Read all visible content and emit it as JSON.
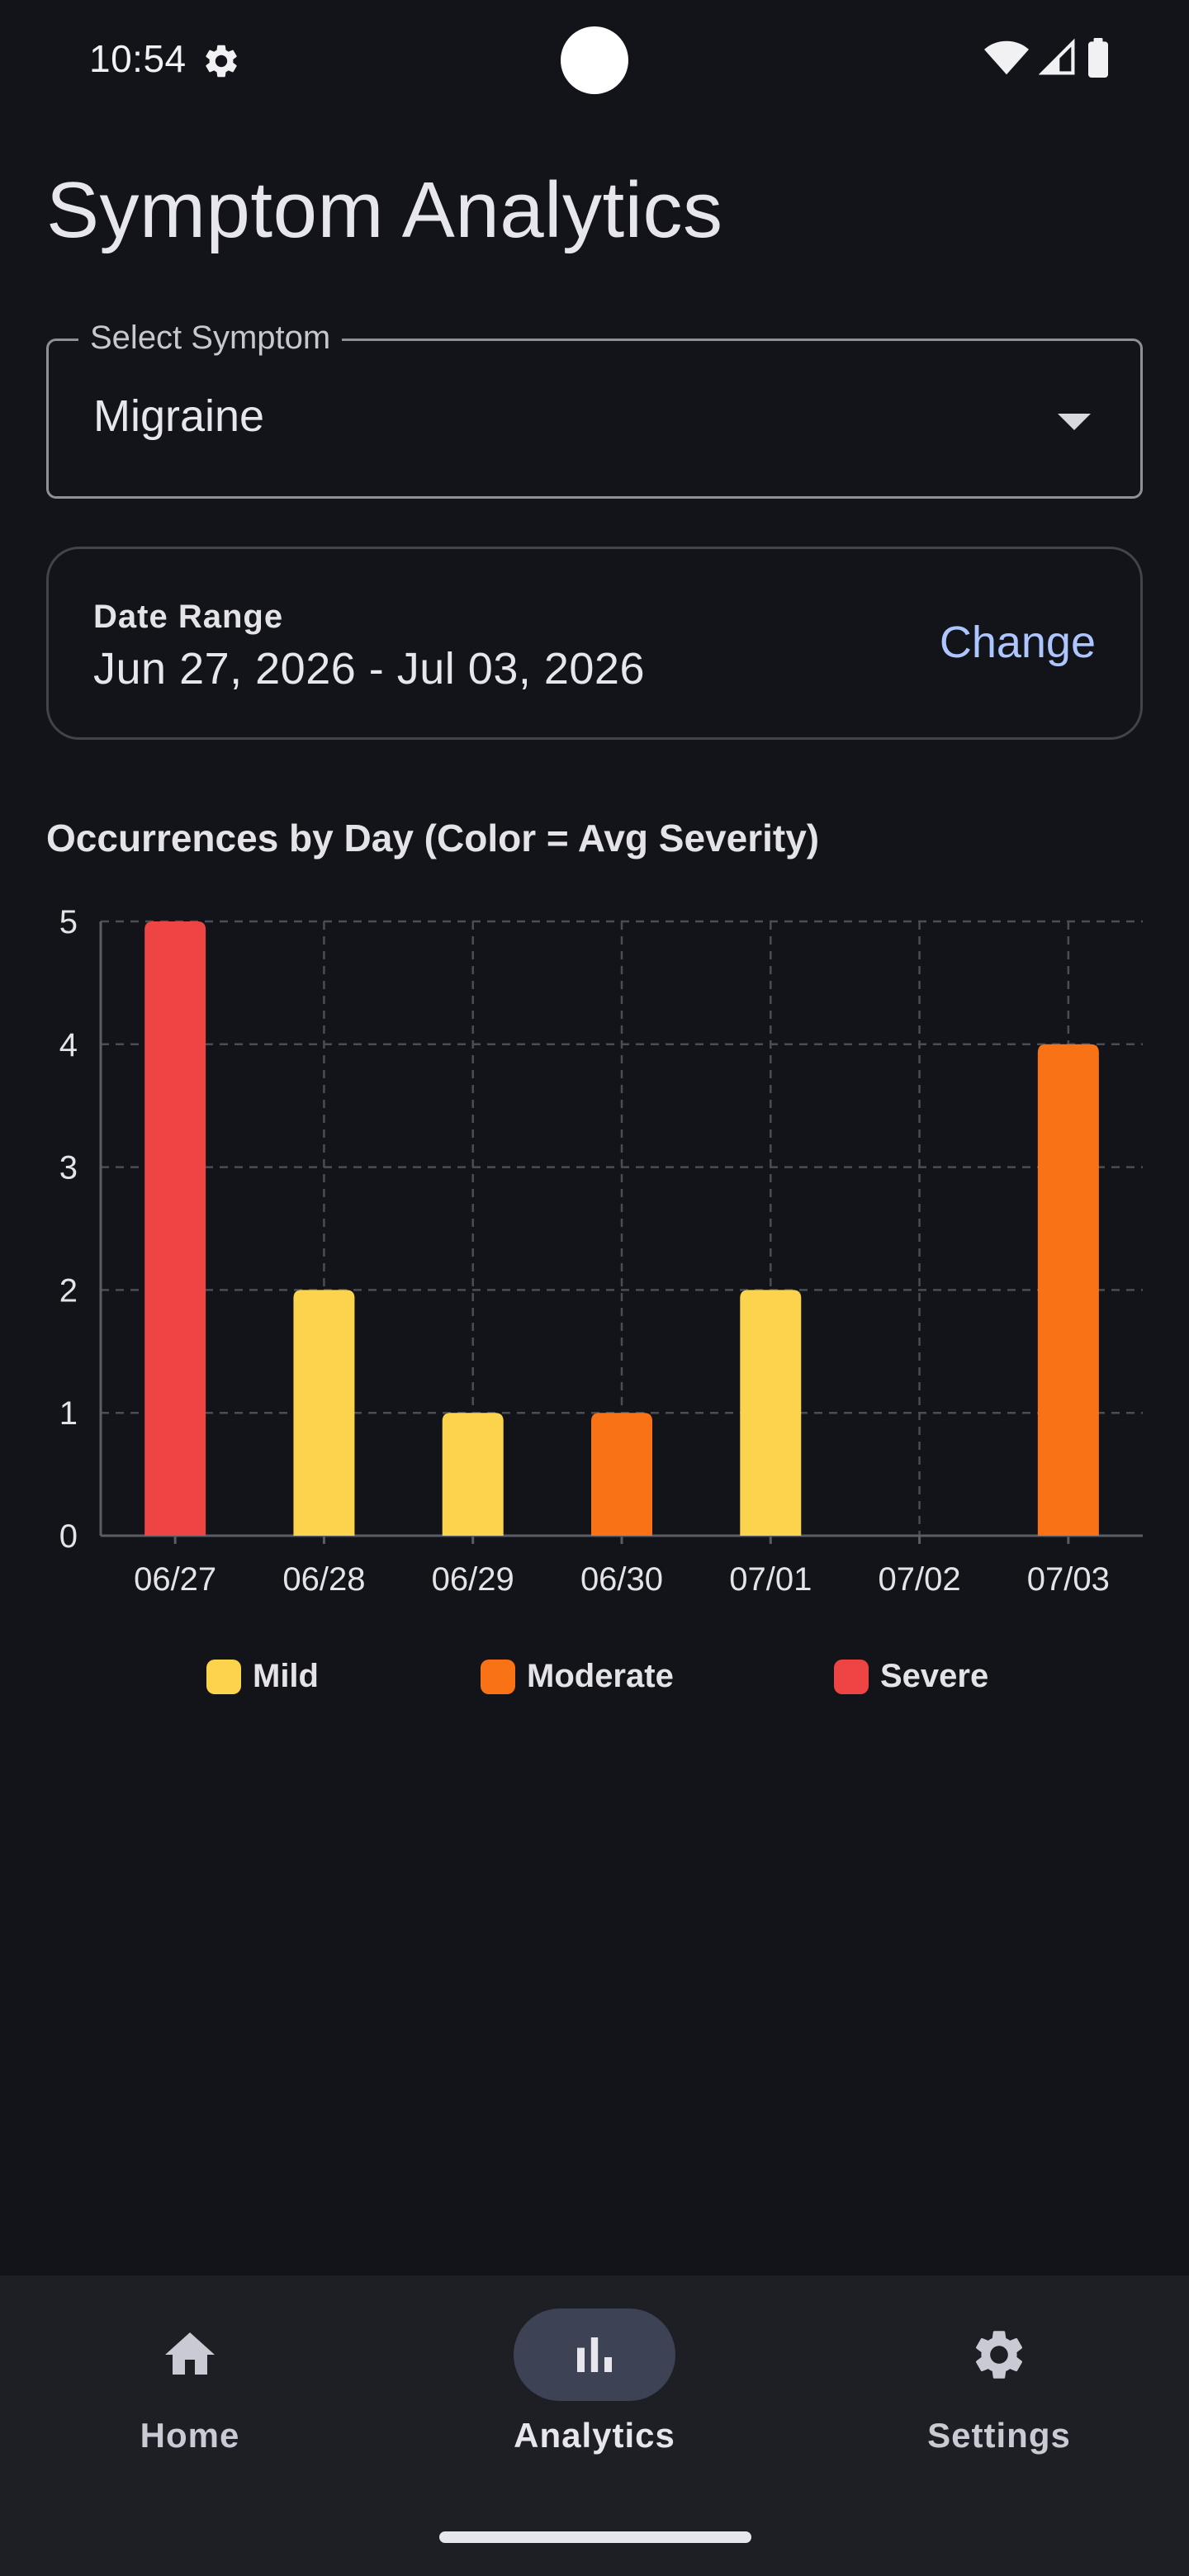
{
  "status_bar": {
    "time": "10:54",
    "icons": [
      "settings-icon",
      "wifi-icon",
      "signal-icon",
      "battery-icon"
    ]
  },
  "page": {
    "title": "Symptom Analytics"
  },
  "symptom_select": {
    "label": "Select Symptom",
    "value": "Migraine"
  },
  "date_range": {
    "label": "Date Range",
    "value": "Jun 27, 2026 - Jul 03, 2026",
    "change_label": "Change"
  },
  "chart_title": "Occurrences by Day (Color = Avg Severity)",
  "chart_data": {
    "type": "bar",
    "categories": [
      "06/27",
      "06/28",
      "06/29",
      "06/30",
      "07/01",
      "07/02",
      "07/03"
    ],
    "values": [
      5,
      2,
      1,
      1,
      2,
      0,
      4
    ],
    "severity": [
      "Severe",
      "Mild",
      "Mild",
      "Moderate",
      "Mild",
      null,
      "Moderate"
    ],
    "ylim": [
      0,
      5
    ],
    "yticks": [
      "0",
      "1",
      "2",
      "3",
      "4",
      "5"
    ],
    "grid": true,
    "legend_position": "bottom",
    "legend": [
      {
        "label": "Mild",
        "color": "#fcd34d"
      },
      {
        "label": "Moderate",
        "color": "#f97316"
      },
      {
        "label": "Severe",
        "color": "#ef4444"
      }
    ],
    "colors": {
      "Mild": "#fcd34d",
      "Moderate": "#f97316",
      "Severe": "#ef4444"
    }
  },
  "bottom_nav": {
    "items": [
      {
        "label": "Home",
        "icon": "home-icon",
        "active": false
      },
      {
        "label": "Analytics",
        "icon": "bar-chart-icon",
        "active": true
      },
      {
        "label": "Settings",
        "icon": "settings-icon",
        "active": false
      }
    ]
  },
  "colors": {
    "background": "#131419",
    "accent": "#aec6ff",
    "nav_background": "#1d1f25",
    "nav_active_pill": "#3d4254"
  }
}
